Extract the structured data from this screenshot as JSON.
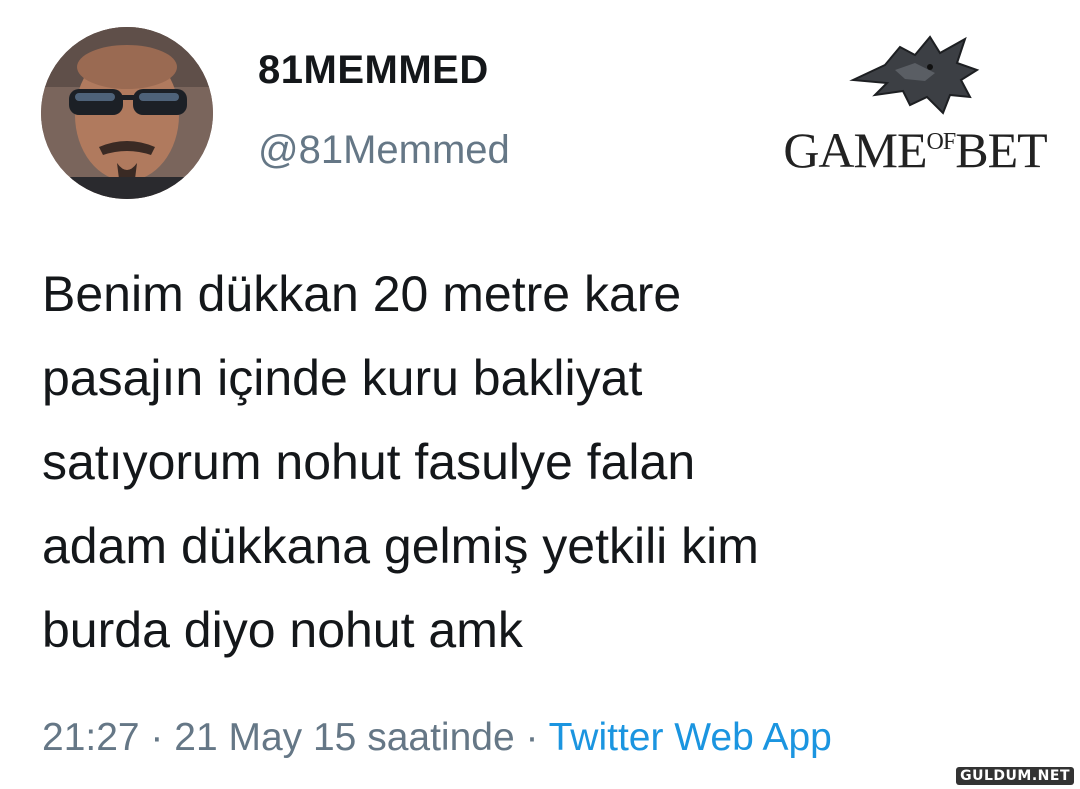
{
  "tweet": {
    "display_name": "81MEMMED",
    "handle": "@81Memmed",
    "text_lines": [
      "Benim dükkan 20 metre kare",
      "pasajın içinde kuru bakliyat",
      "satıyorum nohut fasulye falan",
      "adam dükkana gelmiş yetkili kim",
      "burda diyo nohut amk"
    ],
    "timestamp": "21:27 · 21 May 15 saatinde · ",
    "source": "Twitter Web App"
  },
  "logo": {
    "part1": "GAME",
    "part2": "OF",
    "part3": "BET",
    "icon": "wolf-head-icon"
  },
  "watermark": "GULDUM.NET",
  "colors": {
    "text": "#14171a",
    "muted": "#657786",
    "link": "#1b95e0"
  }
}
